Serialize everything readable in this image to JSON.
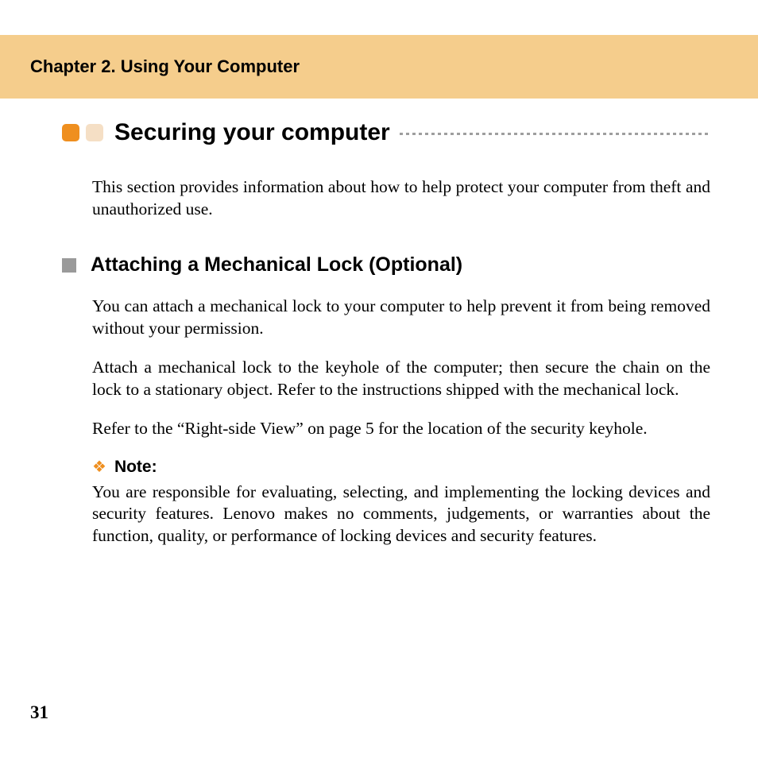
{
  "header": {
    "chapter_title": "Chapter 2. Using Your Computer"
  },
  "section": {
    "title": "Securing your computer",
    "intro": "This section provides information about how to help protect your computer from theft and unauthorized use."
  },
  "subsection": {
    "title": "Attaching a Mechanical Lock (Optional)",
    "p1": "You can attach a mechanical lock to your computer to help prevent it from being removed without your permission.",
    "p2": "Attach a mechanical lock to the keyhole of the computer; then secure the chain on the lock to a stationary object. Refer to the instructions shipped with the mechanical lock.",
    "p3": "Refer to the “Right-side View” on page 5 for the location of the security keyhole."
  },
  "note": {
    "label": "Note:",
    "body": "You are responsible for evaluating, selecting, and implementing the locking devices and security features. Lenovo makes no comments, judgements, or warranties about the function, quality, or performance of locking devices and security features."
  },
  "page_number": "31"
}
